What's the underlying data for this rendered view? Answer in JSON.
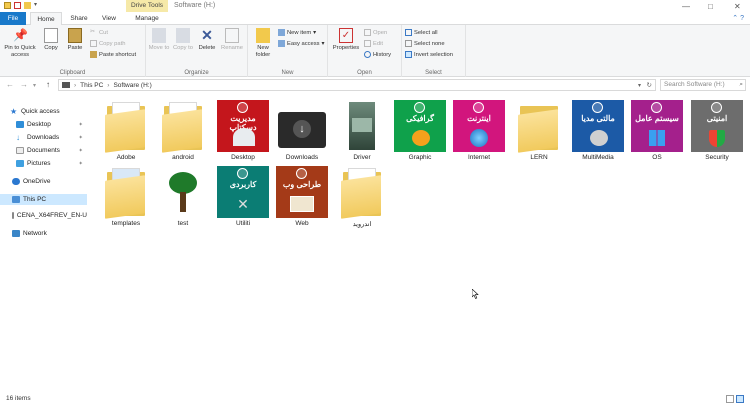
{
  "window": {
    "context_tab": "Drive Tools",
    "title": "Software (H:)",
    "controls": [
      "—",
      "□",
      "✕"
    ]
  },
  "tabs": {
    "file": "File",
    "home": "Home",
    "share": "Share",
    "view": "View",
    "manage": "Manage"
  },
  "ribbon": {
    "clipboard": {
      "label": "Clipboard",
      "pin": "Pin to Quick access",
      "copy": "Copy",
      "paste": "Paste",
      "cut": "Cut",
      "copy_path": "Copy path",
      "paste_shortcut": "Paste shortcut"
    },
    "organize": {
      "label": "Organize",
      "move_to": "Move to",
      "copy_to": "Copy to",
      "delete": "Delete",
      "rename": "Rename"
    },
    "new": {
      "label": "New",
      "new_folder": "New folder",
      "new_item": "New item",
      "easy_access": "Easy access"
    },
    "open": {
      "label": "Open",
      "properties": "Properties",
      "open": "Open",
      "edit": "Edit",
      "history": "History"
    },
    "select": {
      "label": "Select",
      "select_all": "Select all",
      "select_none": "Select none",
      "invert": "Invert selection"
    }
  },
  "address": {
    "crumbs": [
      "This PC",
      "Software (H:)"
    ],
    "separator": "›",
    "search_placeholder": "Search Software (H:)"
  },
  "nav": {
    "quick_access": "Quick access",
    "desktop": "Desktop",
    "downloads": "Downloads",
    "documents": "Documents",
    "pictures": "Pictures",
    "onedrive": "OneDrive",
    "this_pc": "This PC",
    "drive": "CENA_X64FREV_EN-U",
    "network": "Network"
  },
  "items": [
    {
      "name": "Adobe",
      "kind": "folder",
      "color": "#e9c455"
    },
    {
      "name": "android",
      "kind": "folder",
      "color": "#e9c455"
    },
    {
      "name": "Desktop",
      "kind": "tile",
      "caption": "مدیریت دسکتاپ",
      "color": "#c4161c"
    },
    {
      "name": "Downloads",
      "kind": "dark",
      "color": "#2a2a2a"
    },
    {
      "name": "Driver",
      "kind": "box",
      "color": "#3f5a4c"
    },
    {
      "name": "Graphic",
      "kind": "tile",
      "caption": "گرافیکی",
      "color": "#0fa14b"
    },
    {
      "name": "Internet",
      "kind": "tile",
      "caption": "اینترنت",
      "color": "#d2157d"
    },
    {
      "name": "LERN",
      "kind": "folder",
      "color": "#e9c455"
    },
    {
      "name": "MultiMedia",
      "kind": "tile",
      "caption": "مالتی مدیا",
      "color": "#1c5aa6"
    },
    {
      "name": "OS",
      "kind": "tile",
      "caption": "سیستم عامل",
      "color": "#a4208c"
    },
    {
      "name": "Security",
      "kind": "tile",
      "caption": "امنیتی",
      "color": "#6d6d6d"
    },
    {
      "name": "templates",
      "kind": "folder",
      "color": "#e9c455"
    },
    {
      "name": "test",
      "kind": "tree",
      "color": "#1f7a2a"
    },
    {
      "name": "Utiliti",
      "kind": "tile",
      "caption": "کاربردی",
      "color": "#0b7d74"
    },
    {
      "name": "Web",
      "kind": "tile",
      "caption": "طراحی وب",
      "color": "#a43a18"
    },
    {
      "name": "اندروید",
      "kind": "folder",
      "color": "#e9c455"
    }
  ],
  "status": {
    "count": "16 items"
  }
}
